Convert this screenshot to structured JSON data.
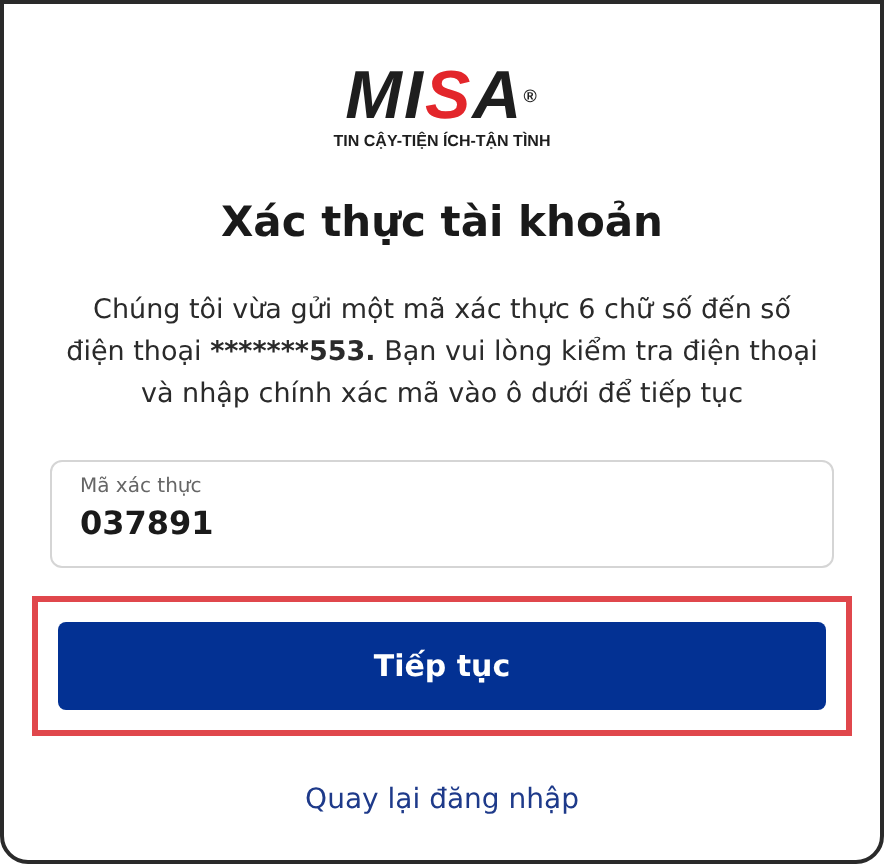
{
  "logo": {
    "parts": [
      {
        "text": "MI",
        "color": "#1e1e1e"
      },
      {
        "text": "S",
        "color": "#e3262b"
      },
      {
        "text": "A",
        "color": "#1e1e1e"
      }
    ],
    "mark": "®",
    "tagline": "TIN CẬY-TIỆN ÍCH-TẬN TÌNH"
  },
  "title": "Xác thực tài khoản",
  "message": [
    {
      "text": "Chúng tôi vừa gửi một mã xác thực 6 chữ số đến số điện thoại ",
      "bold": false
    },
    {
      "text": "*******553.",
      "bold": true
    },
    {
      "text": " Bạn vui lòng kiểm tra điện thoại và nhập chính xác mã vào ô dưới để tiếp tục",
      "bold": false
    }
  ],
  "code_field": {
    "label": "Mã xác thực",
    "value": "037891"
  },
  "continue_button": {
    "label": "Tiếp tục",
    "highlighted": true
  },
  "back_link": "Quay lại đăng nhập"
}
